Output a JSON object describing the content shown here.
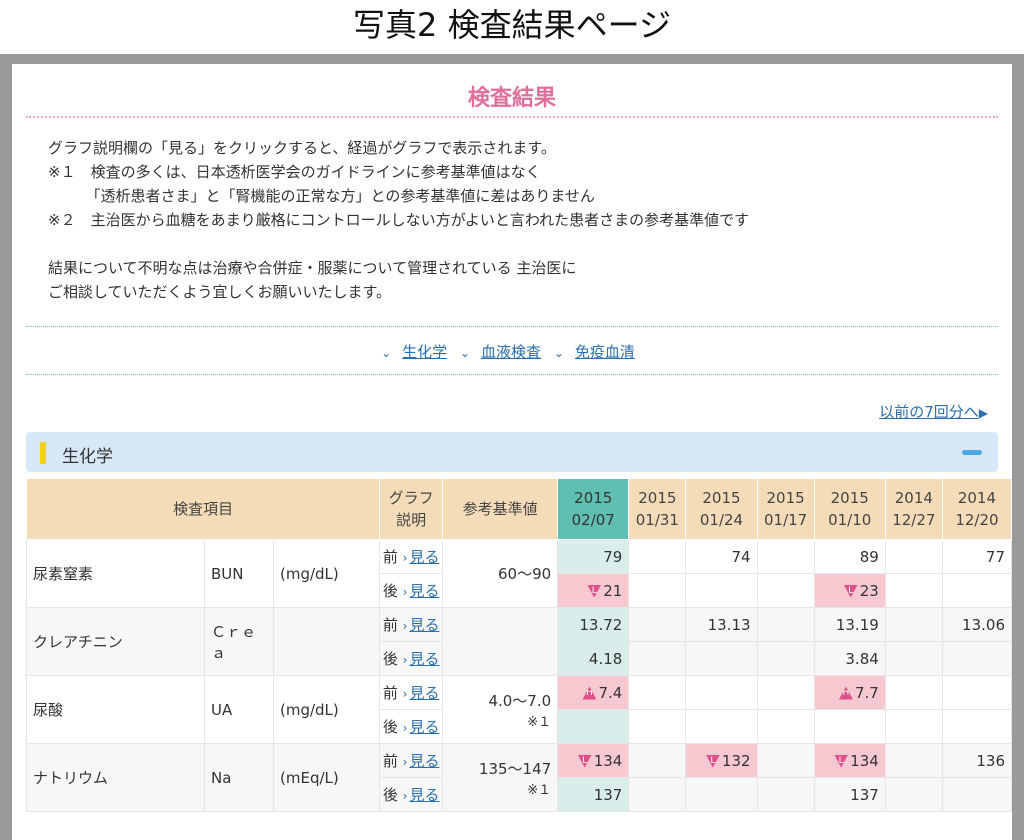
{
  "caption": "写真2 検査結果ページ",
  "title": "検査結果",
  "intro": [
    "グラフ説明欄の「見る」をクリックすると、経過がグラフで表示されます。",
    "※１　検査の多くは、日本透析医学会のガイドラインに参考基準値はなく",
    "　　　「透析患者さま」と「腎機能の正常な方」との参考基準値に差はありません",
    "※２　主治医から血糖をあまり厳格にコントロールしない方がよいと言われた患者さまの参考基準値です",
    "",
    "結果について不明な点は治療や合併症・服薬について管理されている 主治医に",
    "ご相談していただくよう宜しくお願いいたします。"
  ],
  "nav_links": [
    "生化学",
    "血液検査",
    "免疫血清"
  ],
  "prev_link": "以前の7回分へ",
  "section": "生化学",
  "table": {
    "headers": {
      "item": "検査項目",
      "graph": "グラフ",
      "graph2": "説明",
      "ref": "参考基準値",
      "dates": [
        {
          "y": "2015",
          "d": "02/07"
        },
        {
          "y": "2015",
          "d": "01/31"
        },
        {
          "y": "2015",
          "d": "01/24"
        },
        {
          "y": "2015",
          "d": "01/17"
        },
        {
          "y": "2015",
          "d": "01/10"
        },
        {
          "y": "2014",
          "d": "12/27"
        },
        {
          "y": "2014",
          "d": "12/20"
        }
      ]
    },
    "before": "前",
    "after": "後",
    "see": "見る",
    "rows": [
      {
        "name": "尿素窒素",
        "code": "BUN",
        "unit": "(mg/dL)",
        "ref": "60～90",
        "note": "",
        "pre": [
          "79",
          "",
          "74",
          "",
          "89",
          "",
          "77"
        ],
        "post": [
          "21",
          "",
          "",
          "",
          "23",
          "",
          ""
        ]
      },
      {
        "name": "クレアチニン",
        "code": "Ｃｒｅａ",
        "unit": "",
        "ref": "",
        "note": "",
        "pre": [
          "13.72",
          "",
          "13.13",
          "",
          "13.19",
          "",
          "13.06"
        ],
        "post": [
          "4.18",
          "",
          "",
          "",
          "3.84",
          "",
          ""
        ]
      },
      {
        "name": "尿酸",
        "code": "UA",
        "unit": "(mg/dL)",
        "ref": "4.0～7.0",
        "note": "※１",
        "pre": [
          "7.4",
          "",
          "",
          "",
          "7.7",
          "",
          ""
        ],
        "post": [
          "",
          "",
          "",
          "",
          "",
          "",
          ""
        ]
      },
      {
        "name": "ナトリウム",
        "code": "Na",
        "unit": "(mEq/L)",
        "ref": "135～147",
        "note": "※１",
        "pre": [
          "134",
          "",
          "132",
          "",
          "134",
          "",
          "136"
        ],
        "post": [
          "137",
          "",
          "",
          "",
          "137",
          "",
          ""
        ]
      }
    ],
    "badge_low": "L",
    "badge_high": "H"
  }
}
